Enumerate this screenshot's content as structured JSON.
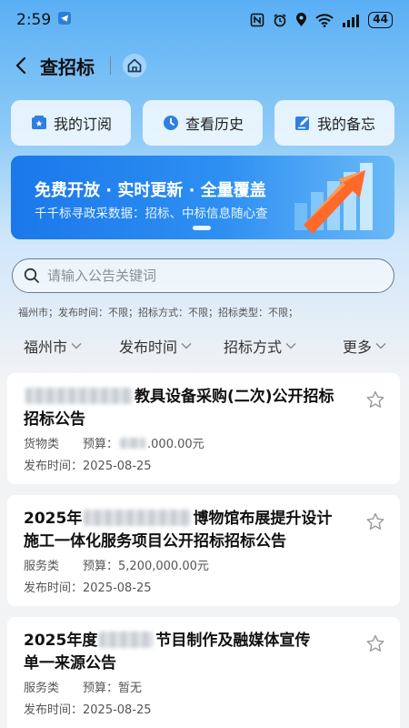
{
  "status_bar": {
    "time": "2:59",
    "battery": "44"
  },
  "nav": {
    "title": "查招标"
  },
  "quick_actions": [
    {
      "label": "我的订阅",
      "icon": "subscription-icon"
    },
    {
      "label": "查看历史",
      "icon": "clock-icon"
    },
    {
      "label": "我的备忘",
      "icon": "memo-icon"
    }
  ],
  "banner": {
    "title": "免费开放 · 实时更新 · 全量覆盖",
    "subtitle": "千千标寻政采数据：招标、中标信息随心查"
  },
  "search": {
    "placeholder": "请输入公告关键词"
  },
  "filter_summary": "福州市；发布时间：不限；招标方式：不限；招标类型：不限；",
  "filters": [
    {
      "label": "福州市"
    },
    {
      "label": "发布时间"
    },
    {
      "label": "招标方式"
    },
    {
      "label": "更多"
    }
  ],
  "listings": [
    {
      "title_prefix": "",
      "title_suffix": "教具设备采购(二次)公开招标",
      "title_line2": "招标公告",
      "category": "货物类",
      "budget_label": "预算：",
      "budget_value": ".000.00元",
      "date_label": "发布时间：",
      "date": "2025-08-25"
    },
    {
      "title_prefix": "2025年",
      "title_suffix": "博物馆布展提升设计",
      "title_line2": "施工一体化服务项目公开招标招标公告",
      "category": "服务类",
      "budget_label": "预算：",
      "budget_value": "5,200,000.00元",
      "date_label": "发布时间：",
      "date": "2025-08-25"
    },
    {
      "title_prefix": "2025年度",
      "title_suffix": "节目制作及融媒体宣传",
      "title_line2": "单一来源公告",
      "category": "服务类",
      "budget_label": "预算：",
      "budget_value": "暂无",
      "date_label": "发布时间：",
      "date": "2025-08-25"
    }
  ]
}
